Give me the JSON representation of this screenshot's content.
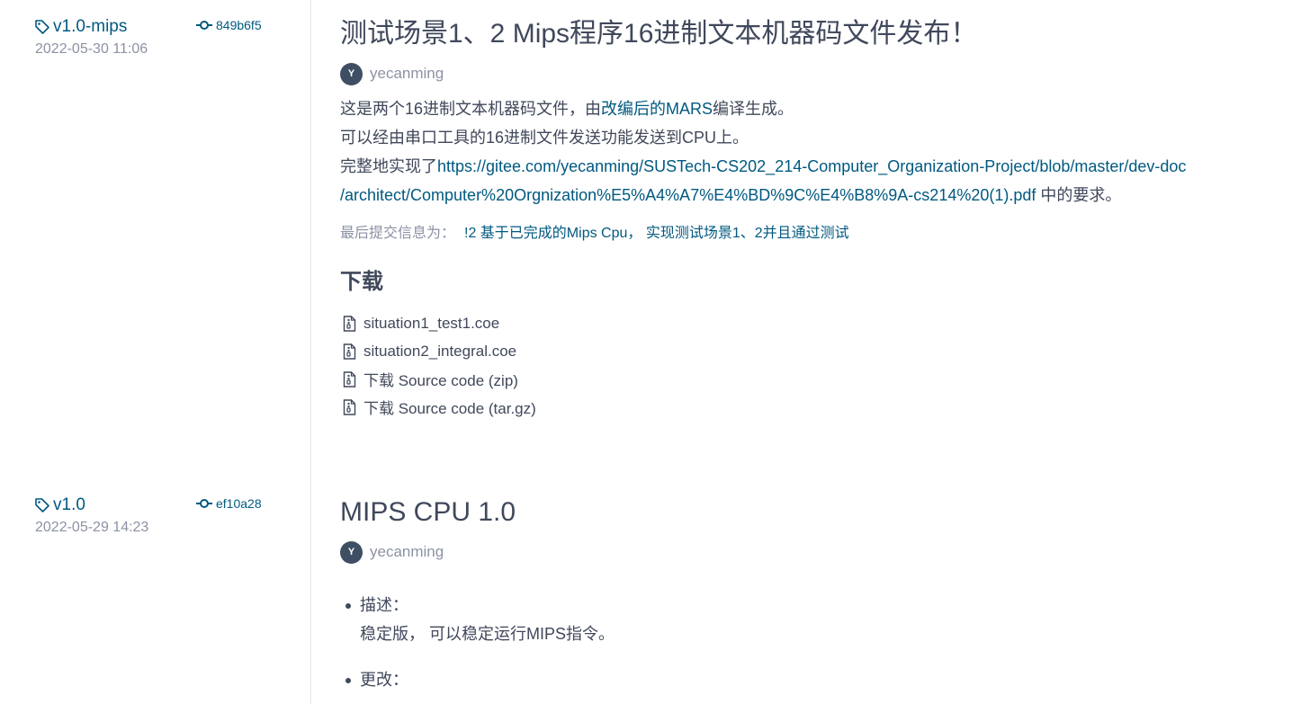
{
  "releases": [
    {
      "tag": "v1.0-mips",
      "commit": "849b6f5",
      "date": "2022-05-30 11:06",
      "title": "测试场景1、2 Mips程序16进制文本机器码文件发布！",
      "author": "yecanming",
      "avatar_letter": "Y",
      "desc": {
        "line1_pre": "这是两个16进制文本机器码文件，由",
        "line1_link": "改编后的MARS",
        "line1_post": "编译生成。",
        "line2": "可以经由串口工具的16进制文件发送功能发送到CPU上。",
        "line3_pre": "完整地实现了",
        "line3_link": "https://gitee.com/yecanming/SUSTech-CS202_214-Computer_Organization-Project/blob/master/dev-doc",
        "line4_link": "/architect/Computer%20Orgnization%E5%A4%A7%E4%BD%9C%E4%B8%9A-cs214%20(1).pdf",
        "line4_post": " 中的要求。"
      },
      "last_commit_label": "最后提交信息为：",
      "last_commit_text": "!2 基于已完成的Mips Cpu， 实现测试场景1、2并且通过测试",
      "downloads_title": "下载",
      "downloads": [
        "situation1_test1.coe",
        "situation2_integral.coe",
        "下载 Source code (zip)",
        "下载 Source code (tar.gz)"
      ]
    },
    {
      "tag": "v1.0",
      "commit": "ef10a28",
      "date": "2022-05-29 14:23",
      "title": "MIPS CPU 1.0",
      "author": "yecanming",
      "avatar_letter": "Y",
      "bullets": [
        {
          "label": "描述：",
          "text": "稳定版， 可以稳定运行MIPS指令。"
        },
        {
          "label": "更改：",
          "text": ""
        }
      ]
    }
  ],
  "colors": {
    "link": "#005980",
    "text": "#40485b",
    "muted": "#8c92a4",
    "avatar_bg": "#3e4f63",
    "divider": "#e3e9ed"
  },
  "icons": {
    "tag": "tag-icon",
    "commit": "commit-icon",
    "file": "file-zip-icon"
  }
}
